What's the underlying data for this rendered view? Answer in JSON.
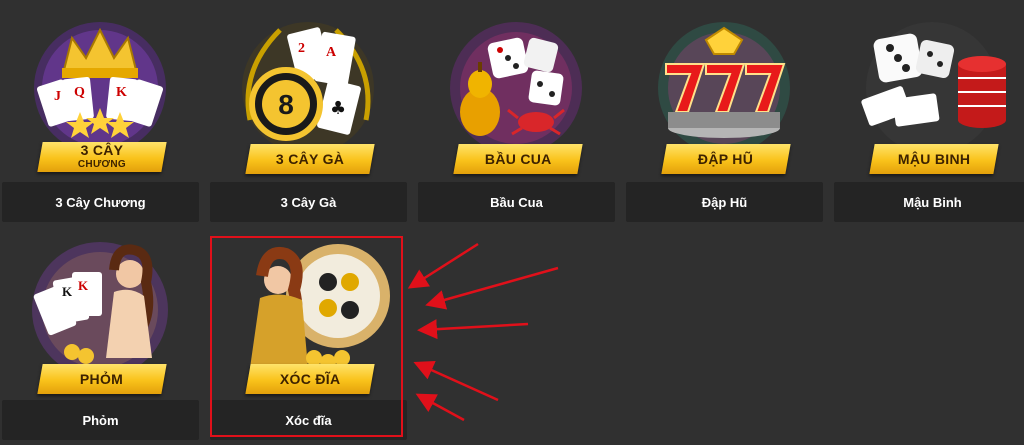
{
  "games": [
    {
      "banner_line1": "3 CÂY",
      "banner_line2": "CHƯƠNG",
      "label": "3 Cây Chương",
      "icon": "crown-cards-icon"
    },
    {
      "banner": "3 CÂY GÀ",
      "label": "3 Cây Gà",
      "icon": "coin-8-cards-icon"
    },
    {
      "banner": "BẦU CUA",
      "label": "Bầu Cua",
      "icon": "dice-gourd-crab-icon"
    },
    {
      "banner": "ĐẬP HŨ",
      "label": "Đập Hũ",
      "icon": "slot-777-icon"
    },
    {
      "banner": "MẬU BINH",
      "label": "Mậu Binh",
      "icon": "dice-chips-cards-icon"
    },
    {
      "banner": "PHỎM",
      "label": "Phỏm",
      "icon": "girl-cards-icon"
    },
    {
      "banner": "XÓC ĐĨA",
      "label": "Xóc đĩa",
      "icon": "girl-plate-icon"
    }
  ],
  "colors": {
    "page_bg": "#303030",
    "label_bg": "#242424",
    "banner": "#f9c21a",
    "highlight": "#e0101a"
  }
}
